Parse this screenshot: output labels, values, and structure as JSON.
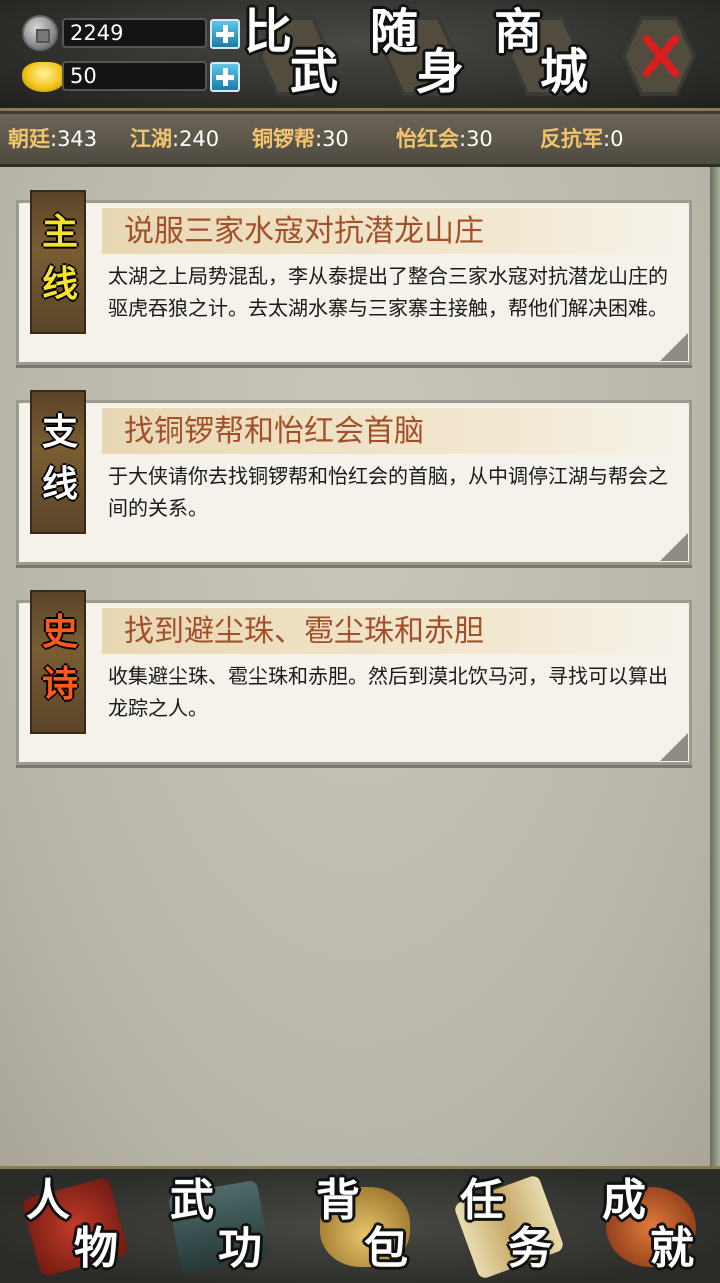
{
  "currency": {
    "coins": "2249",
    "ingots": "50"
  },
  "top_buttons": [
    {
      "c1": "比",
      "c2": "武"
    },
    {
      "c1": "随",
      "c2": "身"
    },
    {
      "c1": "商",
      "c2": "城"
    }
  ],
  "factions": [
    {
      "name": "朝廷",
      "value": ":343"
    },
    {
      "name": "江湖",
      "value": ":240"
    },
    {
      "name": "铜锣帮",
      "value": ":30"
    },
    {
      "name": "怡红会",
      "value": ":30"
    },
    {
      "name": "反抗军",
      "value": ":0"
    }
  ],
  "quests": [
    {
      "tab": [
        "主",
        "线"
      ],
      "title": "说服三家水寇对抗潜龙山庄",
      "desc": "太湖之上局势混乱，李从泰提出了整合三家水寇对抗潜龙山庄的驱虎吞狼之计。去太湖水寨与三家寨主接触，帮他们解决困难。"
    },
    {
      "tab": [
        "支",
        "线"
      ],
      "title": "找铜锣帮和怡红会首脑",
      "desc": "于大侠请你去找铜锣帮和怡红会的首脑，从中调停江湖与帮会之间的关系。"
    },
    {
      "tab": [
        "史",
        "诗"
      ],
      "title": "找到避尘珠、雹尘珠和赤胆",
      "desc": "收集避尘珠、雹尘珠和赤胆。然后到漠北饮马河，寻找可以算出龙踪之人。"
    }
  ],
  "bottom_nav": [
    {
      "c1": "人",
      "c2": "物",
      "icon": "flag-icon"
    },
    {
      "c1": "武",
      "c2": "功",
      "icon": "book-icon"
    },
    {
      "c1": "背",
      "c2": "包",
      "icon": "bag-icon"
    },
    {
      "c1": "任",
      "c2": "务",
      "icon": "scroll-icon"
    },
    {
      "c1": "成",
      "c2": "就",
      "icon": "trophy-icon"
    }
  ],
  "colors": {
    "quest_title": "#a2502a",
    "tab_main": "#f5e22a",
    "tab_epic": "#ff5a1a",
    "faction_name": "#f2c46d",
    "close_x": "#d81f1f"
  }
}
